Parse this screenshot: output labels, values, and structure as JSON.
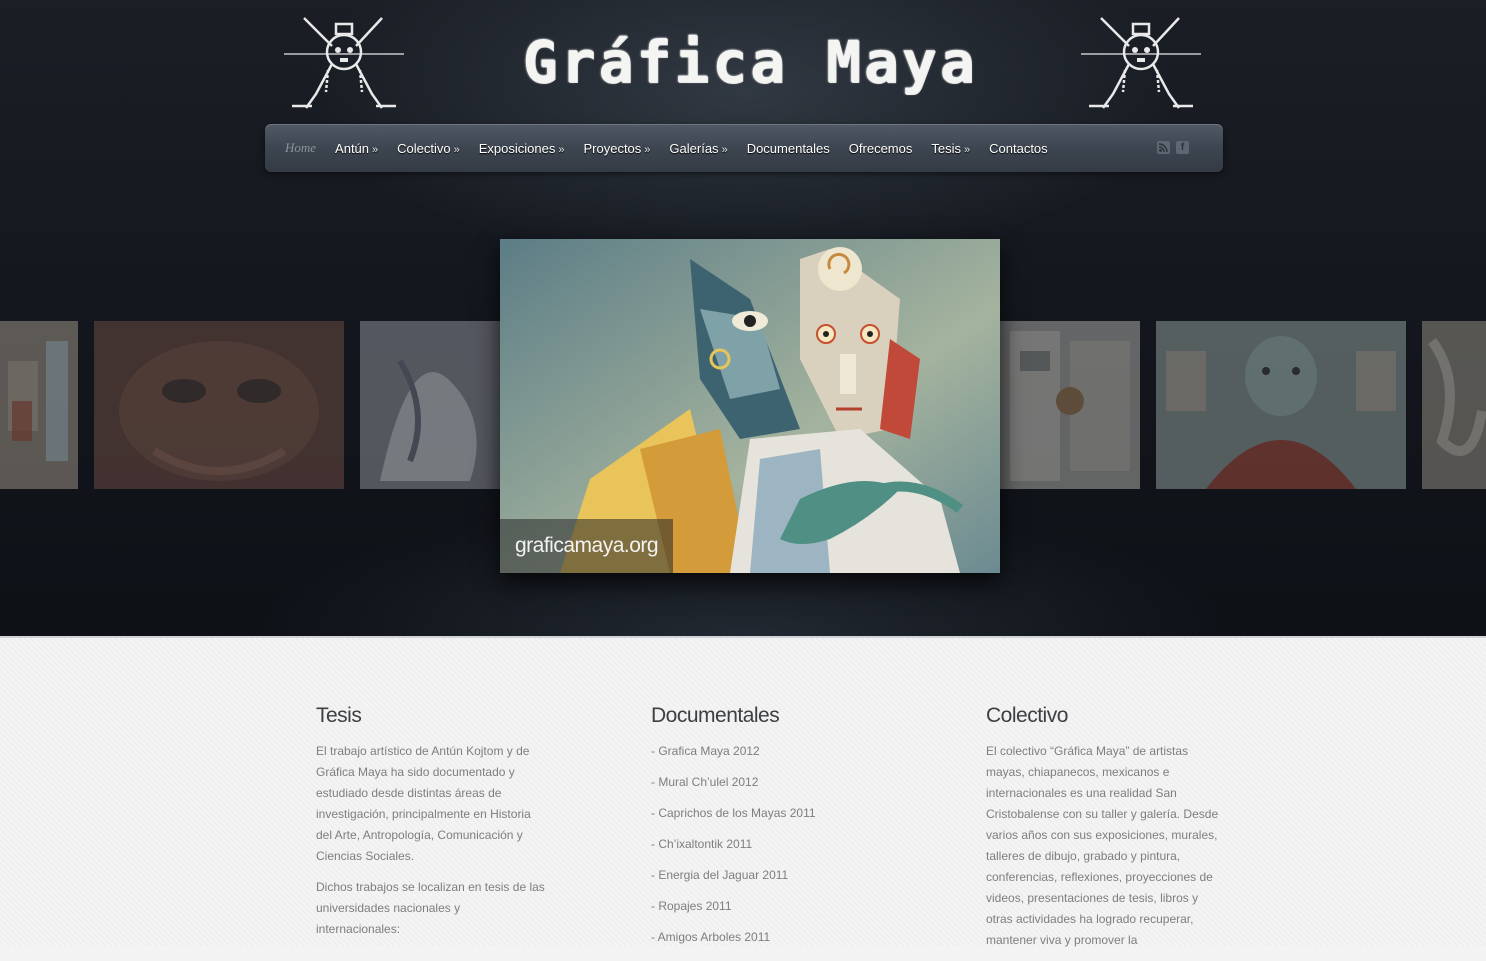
{
  "header": {
    "title": "Gráfica Maya"
  },
  "nav": {
    "items": [
      {
        "label": "Home"
      },
      {
        "label": "Antún",
        "arrow": "»"
      },
      {
        "label": "Colectivo",
        "arrow": "»"
      },
      {
        "label": "Exposiciones",
        "arrow": "»"
      },
      {
        "label": "Proyectos",
        "arrow": "»"
      },
      {
        "label": "Galerías",
        "arrow": "»"
      },
      {
        "label": "Documentales"
      },
      {
        "label": "Ofrecemos"
      },
      {
        "label": "Tesis",
        "arrow": "»"
      },
      {
        "label": "Contactos"
      }
    ],
    "icons": [
      "rss-icon",
      "facebook-icon"
    ],
    "facebook_glyph": "f"
  },
  "slider": {
    "caption": "graficamaya.org"
  },
  "widgets": {
    "tesis": {
      "title": "Tesis",
      "paragraphs": [
        "El trabajo artístico de Antún Kojtom y de Gráfica Maya ha sido documentado y estudiado desde distintas áreas de investigación, principalmente en Historia del Arte, Antropología, Comunicación y Ciencias Sociales.",
        "Dichos trabajos se localizan en tesis de las universidades nacionales y internacionales:"
      ]
    },
    "documentales": {
      "title": "Documentales",
      "items": [
        "- Grafica Maya 2012",
        "- Mural Ch’ulel 2012",
        "- Caprichos de los Mayas 2011",
        "- Ch’ixaltontik 2011",
        "- Energia del Jaguar 2011",
        "- Ropajes 2011",
        "- Amigos Arboles 2011"
      ]
    },
    "colectivo": {
      "title": "Colectivo",
      "paragraph": "El colectivo “Gráfica Maya” de artistas mayas, chiapanecos, mexicanos e internacionales es una realidad San Cristobalense con su taller y galería. Desde varios años con sus exposiciones, murales, talleres de dibujo, grabado y pintura, conferencias, reflexiones, proyecciones de videos, presentaciones de tesis, libros y otras actividades ha logrado recuperar, mantener viva y promover la"
    }
  },
  "colors": {
    "header_bg": "#12161c",
    "nav_bg": "#3d4550",
    "footer_bg": "#f3f3f3",
    "widget_title": "#3c3f43",
    "widget_text": "#7e7e7e"
  }
}
